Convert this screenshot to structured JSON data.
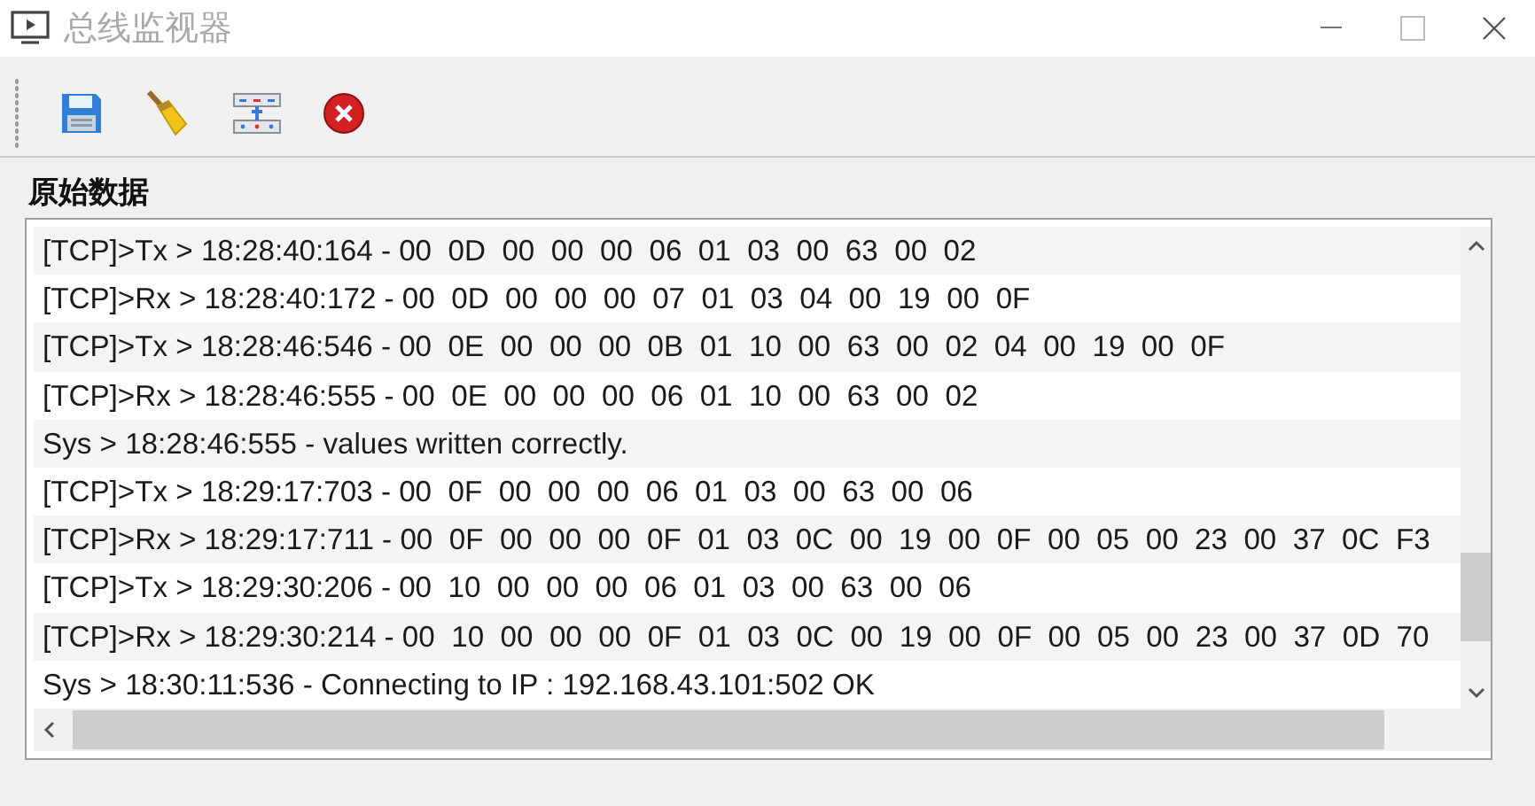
{
  "window": {
    "title": "总线监视器"
  },
  "toolbar": {
    "buttons": [
      {
        "kind": "save"
      },
      {
        "kind": "clear"
      },
      {
        "kind": "network"
      },
      {
        "kind": "stop"
      }
    ]
  },
  "section_label": "原始数据",
  "log": {
    "lines": [
      "[TCP]>Tx > 18:28:40:164 - 00  0D  00  00  00  06  01  03  00  63  00  02",
      "[TCP]>Rx > 18:28:40:172 - 00  0D  00  00  00  07  01  03  04  00  19  00  0F",
      "[TCP]>Tx > 18:28:46:546 - 00  0E  00  00  00  0B  01  10  00  63  00  02  04  00  19  00  0F",
      "[TCP]>Rx > 18:28:46:555 - 00  0E  00  00  00  06  01  10  00  63  00  02",
      "Sys > 18:28:46:555 - values written correctly.",
      "[TCP]>Tx > 18:29:17:703 - 00  0F  00  00  00  06  01  03  00  63  00  06",
      "[TCP]>Rx > 18:29:17:711 - 00  0F  00  00  00  0F  01  03  0C  00  19  00  0F  00  05  00  23  00  37  0C  F3",
      "[TCP]>Tx > 18:29:30:206 - 00  10  00  00  00  06  01  03  00  63  00  06",
      "[TCP]>Rx > 18:29:30:214 - 00  10  00  00  00  0F  01  03  0C  00  19  00  0F  00  05  00  23  00  37  0D  70",
      "Sys > 18:30:11:536 - Connecting to IP : 192.168.43.101:502 OK"
    ]
  }
}
